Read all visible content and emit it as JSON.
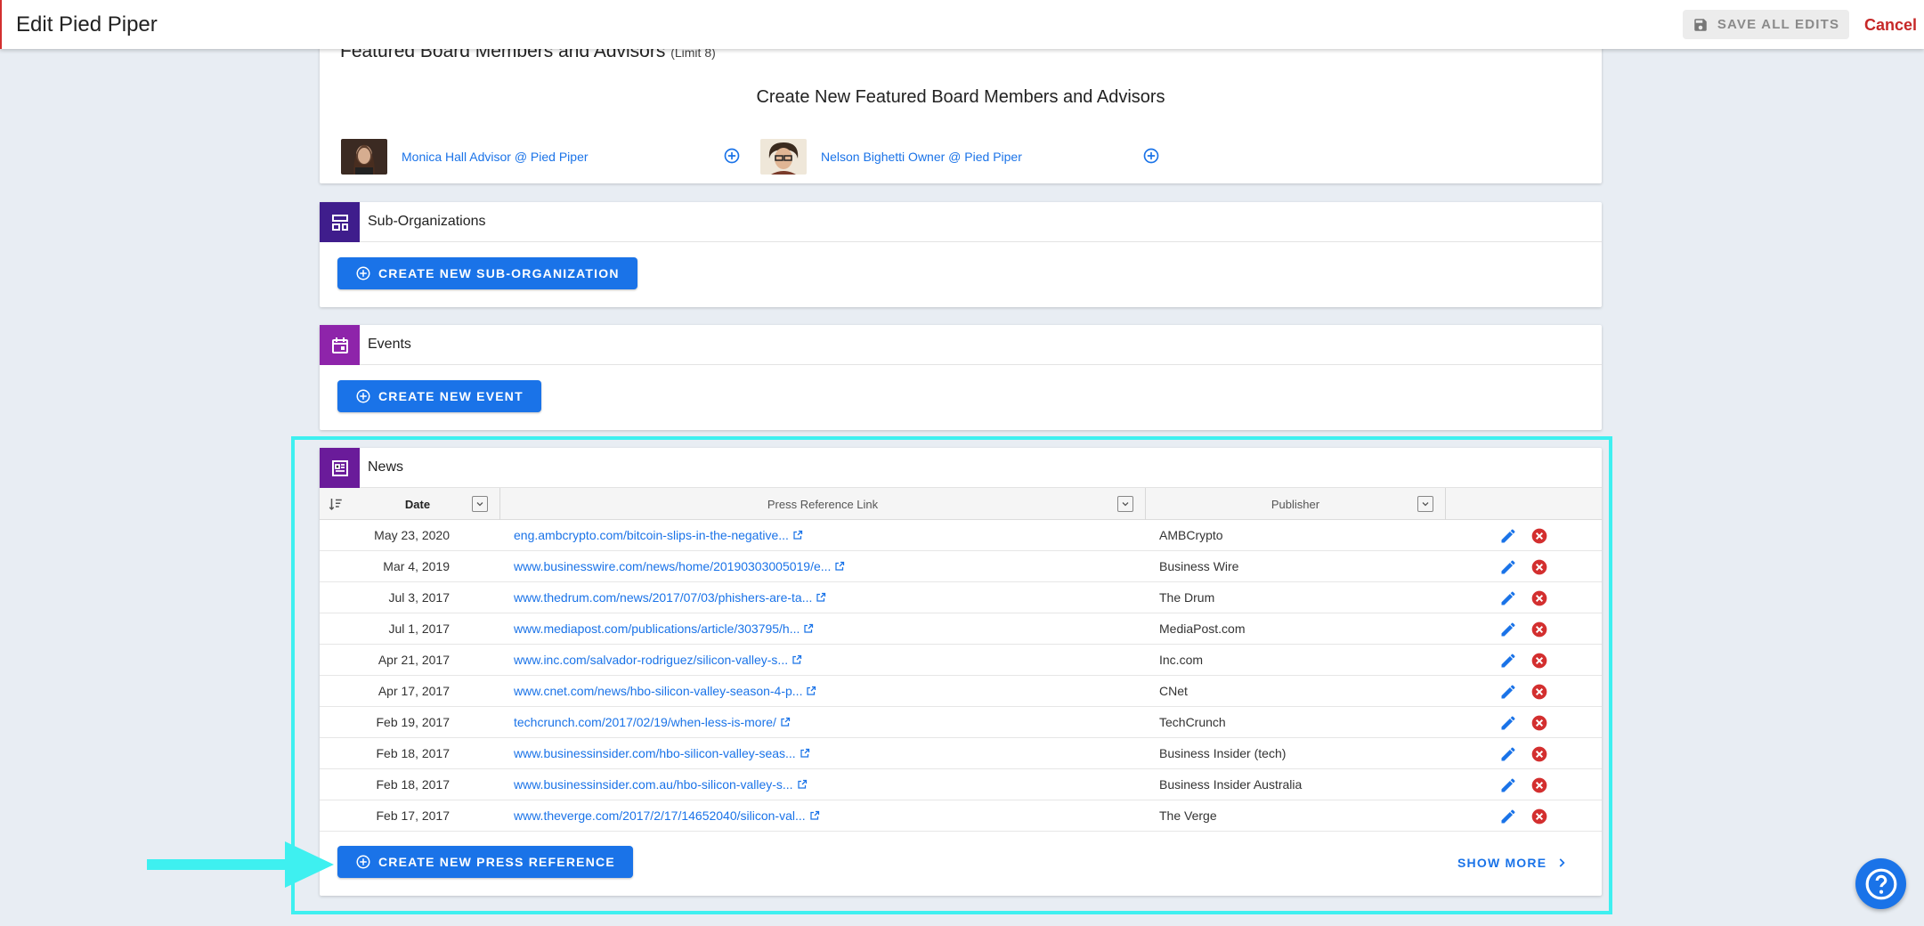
{
  "header": {
    "title": "Edit Pied Piper",
    "save_label": "SAVE ALL EDITS",
    "cancel_label": "Cancel"
  },
  "featured_board": {
    "heading": "Featured Board Members and Advisors",
    "limit_note": "(Limit 8)",
    "create_title": "Create New Featured Board Members and Advisors",
    "members": [
      {
        "name": "Monica Hall Advisor @ Pied Piper"
      },
      {
        "name": "Nelson Bighetti Owner @ Pied Piper"
      }
    ]
  },
  "sub_orgs": {
    "title": "Sub-Organizations",
    "button_label": "CREATE NEW SUB-ORGANIZATION"
  },
  "events": {
    "title": "Events",
    "button_label": "CREATE NEW EVENT"
  },
  "news": {
    "title": "News",
    "columns": {
      "date": "Date",
      "link": "Press Reference Link",
      "publisher": "Publisher"
    },
    "rows": [
      {
        "date": "May 23, 2020",
        "link": "eng.ambcrypto.com/bitcoin-slips-in-the-negative...",
        "publisher": "AMBCrypto"
      },
      {
        "date": "Mar 4, 2019",
        "link": "www.businesswire.com/news/home/20190303005019/e...",
        "publisher": "Business Wire"
      },
      {
        "date": "Jul 3, 2017",
        "link": "www.thedrum.com/news/2017/07/03/phishers-are-ta...",
        "publisher": "The Drum"
      },
      {
        "date": "Jul 1, 2017",
        "link": "www.mediapost.com/publications/article/303795/h...",
        "publisher": "MediaPost.com"
      },
      {
        "date": "Apr 21, 2017",
        "link": "www.inc.com/salvador-rodriguez/silicon-valley-s...",
        "publisher": "Inc.com"
      },
      {
        "date": "Apr 17, 2017",
        "link": "www.cnet.com/news/hbo-silicon-valley-season-4-p...",
        "publisher": "CNet"
      },
      {
        "date": "Feb 19, 2017",
        "link": "techcrunch.com/2017/02/19/when-less-is-more/",
        "publisher": "TechCrunch"
      },
      {
        "date": "Feb 18, 2017",
        "link": "www.businessinsider.com/hbo-silicon-valley-seas...",
        "publisher": "Business Insider (tech)"
      },
      {
        "date": "Feb 18, 2017",
        "link": "www.businessinsider.com.au/hbo-silicon-valley-s...",
        "publisher": "Business Insider Australia"
      },
      {
        "date": "Feb 17, 2017",
        "link": "www.theverge.com/2017/2/17/14652040/silicon-val...",
        "publisher": "The Verge"
      }
    ],
    "create_label": "CREATE NEW PRESS REFERENCE",
    "show_more_label": "SHOW MORE"
  },
  "colors": {
    "primary": "#1a73e8",
    "danger": "#c62828",
    "suborg_icon_bg": "#3f1d8c",
    "events_icon_bg": "#8e24aa",
    "news_icon_bg": "#6a1b9a",
    "highlight": "#3ef0f0"
  },
  "icons": {
    "save": "floppy-disk-icon",
    "add": "add-circle-icon",
    "sort": "sort-icon",
    "filter": "dropdown-filter-icon",
    "external": "external-link-icon",
    "edit": "pencil-icon",
    "delete": "delete-circle-icon",
    "help": "help-icon"
  }
}
